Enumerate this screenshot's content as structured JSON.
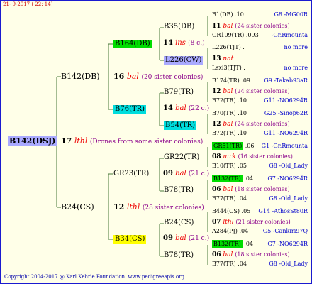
{
  "header": "21- 9-2017 ( 22: 14)",
  "footer": "Copyright 2004-2017 @ Karl Kehrle Foundation.   www.pedigreeapis.org",
  "colors": {
    "line": "#4a7a3a",
    "green_box": "#00dd00",
    "cyan_box": "#00dddd",
    "yellow_box": "#ffff00",
    "blue_box": "#aaaaff"
  },
  "root": {
    "name": "B142(DSJ)",
    "num": "17",
    "code": "lthl",
    "note": "(Drones from some sister colonies)"
  },
  "g1": [
    {
      "name": "B142(DB)",
      "num": "16",
      "code": "bal",
      "note": "(20 sister colonies)"
    },
    {
      "name": "B24(CS)",
      "num": "12",
      "code": "lthl",
      "note": "(28 sister colonies)"
    }
  ],
  "g2": [
    {
      "name": "B164(DB)",
      "num": "14",
      "code": "ins",
      "note": "(8 c.)"
    },
    {
      "name": "B76(TR)",
      "num": "14",
      "code": "bal",
      "note": "(22 c.)"
    },
    {
      "name": "GR23(TR)",
      "num": "09",
      "code": "bal",
      "note": "(21 c.)"
    },
    {
      "name": "B34(CS)",
      "num": "09",
      "code": "bal",
      "note": "(21 c.)"
    }
  ],
  "g3": [
    {
      "name": "B35(DB)",
      "num": "11",
      "code": "bal",
      "note": "(24 sister colonies)"
    },
    {
      "name": "L226(CW)",
      "num": "13",
      "code": "nat",
      "note": ""
    },
    {
      "name": "B79(TR)",
      "num": "12",
      "code": "bal",
      "note": "(24 sister colonies)"
    },
    {
      "name": "B54(TR)",
      "num": "12",
      "code": "bal",
      "note": "(24 sister colonies)"
    },
    {
      "name": "GR22(TR)",
      "num": "08",
      "code": "mrk",
      "note": "(16 sister colonies)"
    },
    {
      "name": "B78(TR)",
      "num": "06",
      "code": "bal",
      "note": "(18 sister colonies)"
    },
    {
      "name": "B24(CS)",
      "num": "07",
      "code": "lthl",
      "note": "(21 sister colonies)"
    },
    {
      "name": "B78(TR)",
      "num": "06",
      "code": "bal",
      "note": "(18 sister colonies)"
    }
  ],
  "g4": [
    {
      "name": "B1(DB)",
      "val": ".10",
      "right": "G8 -MG00R"
    },
    {
      "name": "GR109(TR)",
      "val": ".093",
      "right": "-Gr.Rmounta"
    },
    {
      "name": "L226(TJT)",
      "val": ".",
      "right": "no more"
    },
    {
      "name": "Lsxl3(TJT)",
      "val": ".",
      "right": "no more"
    },
    {
      "name": "B174(TR)",
      "val": ".09",
      "right": "G9 -Takab93aR"
    },
    {
      "name": "B72(TR)",
      "val": ".10",
      "right": "G11 -NO6294R"
    },
    {
      "name": "B70(TR)",
      "val": ".10",
      "right": "G25 -Sinop62R"
    },
    {
      "name": "B72(TR)",
      "val": ".10",
      "right": "G11 -NO6294R"
    },
    {
      "name": "GR51(TR)",
      "val": ".06",
      "right": "G1 -Gr.Rmounta"
    },
    {
      "name": "B10(TR)",
      "val": ".05",
      "right": "G8 -Old_Lady"
    },
    {
      "name": "B132(TR)",
      "val": ".04",
      "right": "G7 -NO6294R"
    },
    {
      "name": "B77(TR)",
      "val": ".04",
      "right": "G8 -Old_Lady"
    },
    {
      "name": "B444(CS)",
      "val": ".05",
      "right": "G14 -AthosSt80R"
    },
    {
      "name": "A284(PJ)",
      "val": ".04",
      "right": "G5 -Cankiri97Q"
    },
    {
      "name": "B132(TR)",
      "val": ".04",
      "right": "G7 -NO6294R"
    },
    {
      "name": "B77(TR)",
      "val": ".04",
      "right": "G8 -Old_Lady"
    }
  ]
}
